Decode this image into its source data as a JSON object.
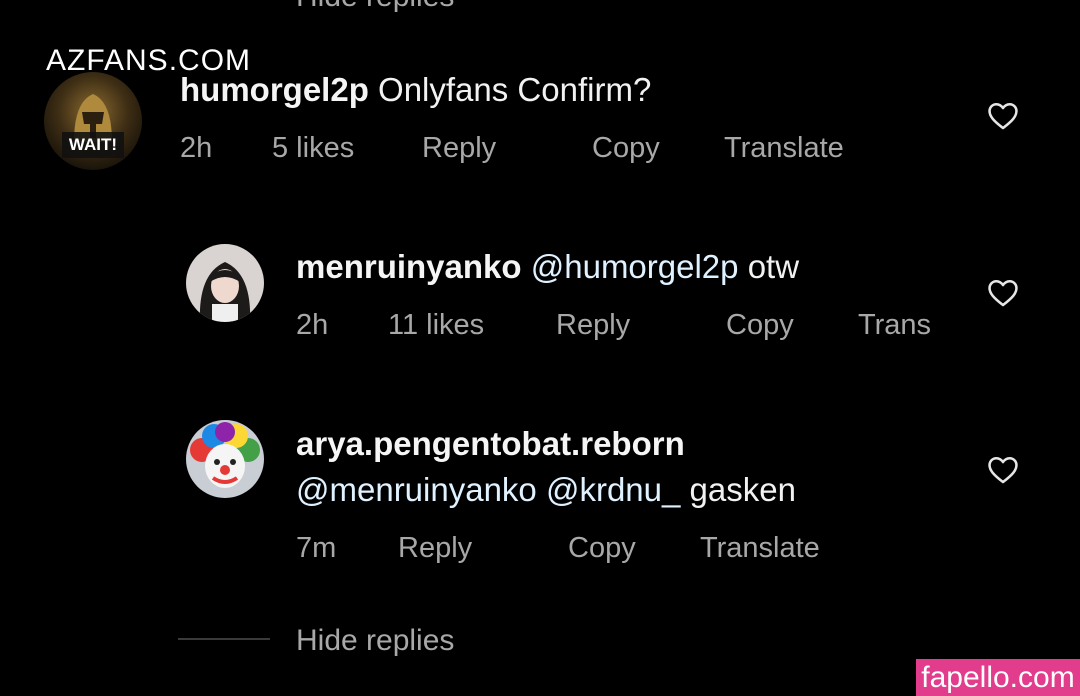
{
  "partial_top": {
    "hide_replies": "Hide replies"
  },
  "watermark_top": "AZFANS.COM",
  "comment": {
    "username": "humorgel2p",
    "text": "Onlyfans Confirm?",
    "avatar_text": "WAIT!",
    "time": "2h",
    "likes": "5 likes",
    "reply": "Reply",
    "copy": "Copy",
    "translate": "Translate"
  },
  "replies": [
    {
      "username": "menruinyanko",
      "mention": "@humorgel2p",
      "text": "otw",
      "time": "2h",
      "likes": "11 likes",
      "reply": "Reply",
      "copy": "Copy",
      "translate": "Trans"
    },
    {
      "username": "arya.pengentobat.reborn",
      "mention1": "@menruinyanko",
      "mention2": "@krdnu_",
      "text": "gasken",
      "time": "7m",
      "reply": "Reply",
      "copy": "Copy",
      "translate": "Translate"
    }
  ],
  "hide_replies": "Hide replies",
  "watermark_bottom": "fapello.com",
  "colors": {
    "background": "#000000",
    "primary_text": "#f2f2f2",
    "secondary_text": "#a8a8a8",
    "mention": "#e0f1ff",
    "watermark_badge": "#e23c8c"
  },
  "icons": [
    "heart-outline-icon"
  ]
}
